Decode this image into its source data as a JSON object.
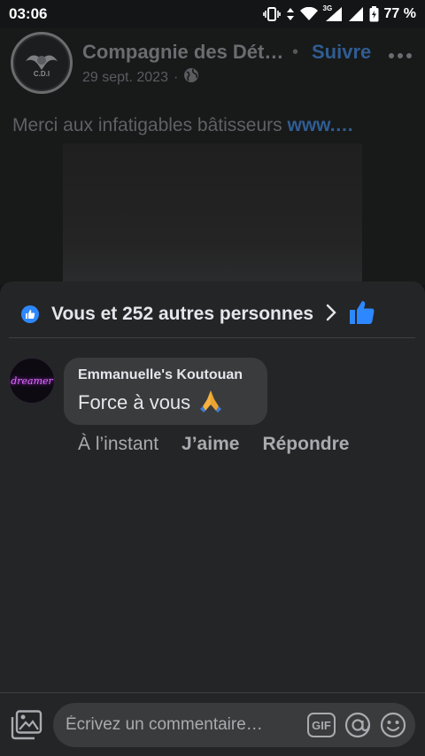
{
  "status_bar": {
    "time": "03:06",
    "network": "3G",
    "battery": "77 %"
  },
  "post": {
    "page_name": "Compagnie des Dét…",
    "separator": "•",
    "follow_label": "Suivre",
    "more_icon": "more-horizontal-icon",
    "date": "29 sept. 2023",
    "date_separator": "·",
    "audience_icon": "globe-icon",
    "avatar_text": "C.D.I",
    "caption_text": "Merci aux infatigables bâtisseurs ",
    "caption_link": "www.…"
  },
  "reactions": {
    "summary": "Vous et 252 autres personnes"
  },
  "comment": {
    "avatar_text": "dreamer",
    "author": "Emmanuelle's Koutouan",
    "text": "Force à vous",
    "time": "À l’instant",
    "like_label": "J’aime",
    "reply_label": "Répondre"
  },
  "composer": {
    "placeholder": "Écrivez un commentaire…",
    "gif_label": "GIF"
  },
  "colors": {
    "accent": "#2d88ff",
    "sheet": "#242526",
    "bubble": "#3a3b3c"
  }
}
